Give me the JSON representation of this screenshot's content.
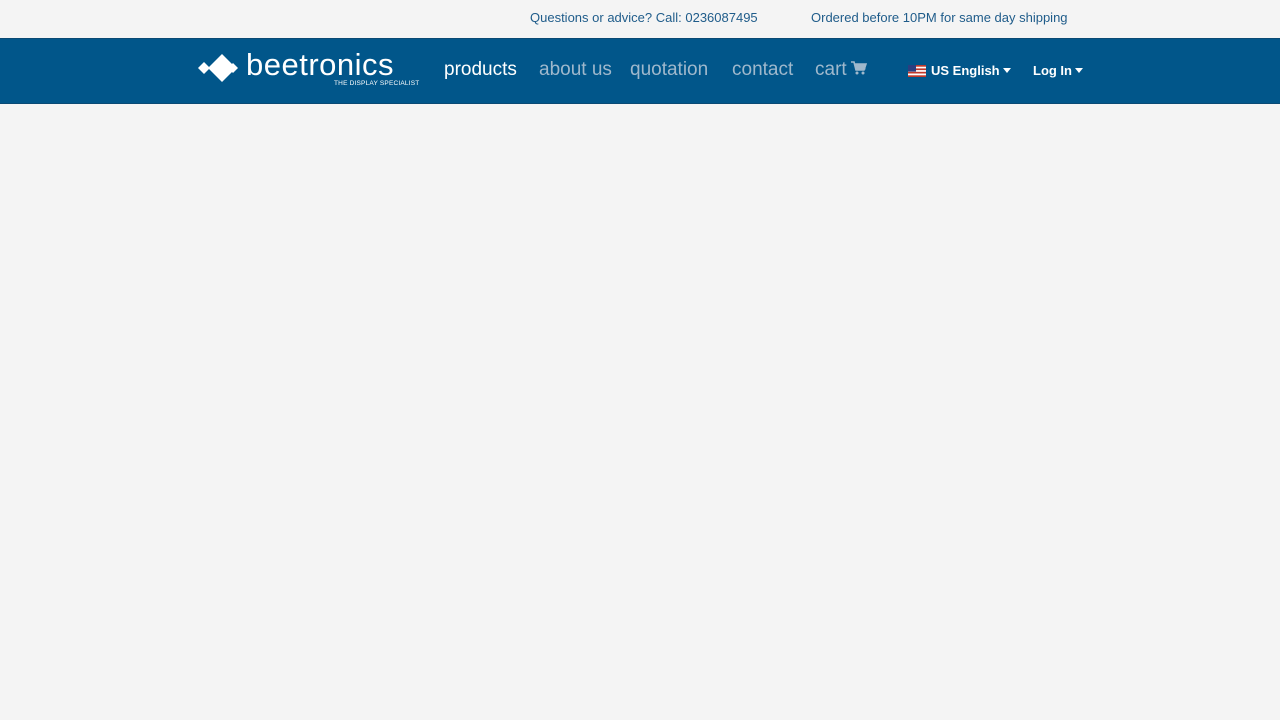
{
  "topbar": {
    "call_text": "Questions or advice? Call: 0236087495",
    "shipping_text": "Ordered before 10PM for same day shipping"
  },
  "brand": {
    "name": "beetronics",
    "tagline": "THE DISPLAY SPECIALIST"
  },
  "nav": {
    "products": "products",
    "about": "about us",
    "quotation": "quotation",
    "contact": "contact",
    "cart": "cart"
  },
  "language": {
    "label": "US English",
    "flag": "us-flag-icon"
  },
  "account": {
    "login_label": "Log In"
  },
  "colors": {
    "navbar_bg": "#01568a",
    "page_bg": "#f4f4f4",
    "topbar_text": "#1f5c8a",
    "nav_inactive": "#9fb8cc",
    "nav_active": "#ffffff"
  },
  "icons": {
    "cart": "shopping-cart-icon",
    "caret": "caret-down-icon"
  }
}
